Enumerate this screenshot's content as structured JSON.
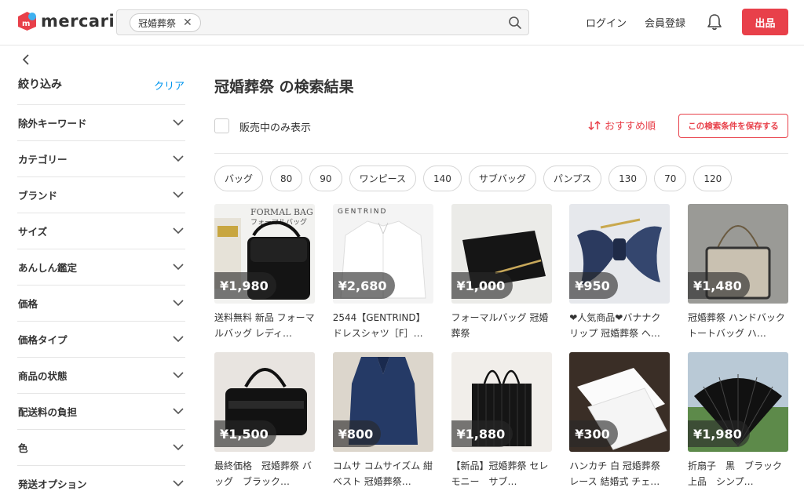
{
  "header": {
    "brand": "mercari",
    "search_chip": "冠婚葬祭",
    "login": "ログイン",
    "register": "会員登録",
    "sell": "出品"
  },
  "sidebar": {
    "title": "絞り込み",
    "clear": "クリア",
    "items": [
      {
        "label": "除外キーワード"
      },
      {
        "label": "カテゴリー"
      },
      {
        "label": "ブランド"
      },
      {
        "label": "サイズ"
      },
      {
        "label": "あんしん鑑定"
      },
      {
        "label": "価格"
      },
      {
        "label": "価格タイプ"
      },
      {
        "label": "商品の状態"
      },
      {
        "label": "配送料の負担"
      },
      {
        "label": "色"
      },
      {
        "label": "発送オプション"
      }
    ]
  },
  "main": {
    "title": "冠婚葬祭 の検索結果",
    "on_sale_label": "販売中のみ表示",
    "sort_label": "おすすめ順",
    "save_label": "この検索条件を保存する",
    "chips": [
      "バッグ",
      "80",
      "90",
      "ワンピース",
      "140",
      "サブバッグ",
      "パンプス",
      "130",
      "70",
      "120"
    ],
    "items": [
      {
        "price": "¥1,980",
        "title": "送料無料 新品 フォーマルバッグ レディ…"
      },
      {
        "price": "¥2,680",
        "title": "2544【GENTRIND】 ドレスシャツ［F］…"
      },
      {
        "price": "¥1,000",
        "title": "フォーマルバッグ 冠婚葬祭"
      },
      {
        "price": "¥950",
        "title": "❤人気商品❤バナナクリップ 冠婚葬祭 へ…"
      },
      {
        "price": "¥1,480",
        "title": "冠婚葬祭 ハンドバック トートバッグ ハ…"
      },
      {
        "price": "¥1,500",
        "title": "最終価格　冠婚葬祭 バッグ　ブラック…"
      },
      {
        "price": "¥800",
        "title": "コムサ コムサイズム 紺 ベスト 冠婚葬祭…"
      },
      {
        "price": "¥1,880",
        "title": "【新品】冠婚葬祭 セレモニー　サブ…"
      },
      {
        "price": "¥300",
        "title": "ハンカチ 白 冠婚葬祭 レース 結婚式 チェ…"
      },
      {
        "price": "¥1,980",
        "title": "折扇子　黒　ブラック　上品　シンプ…"
      }
    ],
    "thumb_texts": {
      "bag1_line1": "FORMAL BAG",
      "bag1_line2": "フォーマルバッグ",
      "shirt_brand": "GENTRIND"
    }
  },
  "colors": {
    "accent": "#e8404a",
    "link": "#0095ee"
  }
}
